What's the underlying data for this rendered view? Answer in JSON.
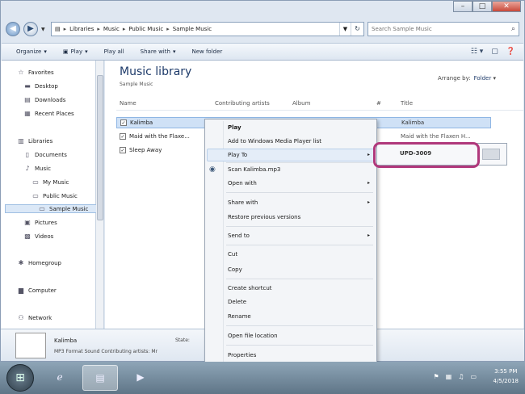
{
  "window": {
    "caption_buttons": [
      "–",
      "□",
      "✕"
    ]
  },
  "address": {
    "crumbs": [
      "Libraries",
      "Music",
      "Public Music",
      "Sample Music"
    ],
    "search_placeholder": "Search Sample Music"
  },
  "toolbar": {
    "organize": "Organize",
    "play": "Play",
    "play_all": "Play all",
    "share_with": "Share with",
    "new_folder": "New folder"
  },
  "navpane": {
    "favorites": "Favorites",
    "desktop": "Desktop",
    "downloads": "Downloads",
    "recent_places": "Recent Places",
    "libraries": "Libraries",
    "documents": "Documents",
    "music": "Music",
    "my_music": "My Music",
    "public_music": "Public Music",
    "sample_music": "Sample Music",
    "pictures": "Pictures",
    "videos": "Videos",
    "homegroup": "Homegroup",
    "computer": "Computer",
    "network": "Network"
  },
  "content": {
    "title": "Music library",
    "subtitle": "Sample Music",
    "arrange_label": "Arrange by:",
    "arrange_value": "Folder",
    "columns": [
      "Name",
      "Contributing artists",
      "Album",
      "#",
      "Title"
    ],
    "rows": [
      {
        "name": "Kalimba",
        "title": "Kalimba"
      },
      {
        "name": "Maid with the Flaxe...",
        "title": "Maid with the Flaxen H..."
      },
      {
        "name": "Sleep Away",
        "title": ""
      }
    ]
  },
  "context_menu": {
    "items": [
      "Play",
      "Add to Windows Media Player list",
      "Play To",
      "Scan Kalimba.mp3",
      "Open with",
      "Share with",
      "Restore previous versions",
      "Send to",
      "Cut",
      "Copy",
      "Create shortcut",
      "Delete",
      "Rename",
      "Open file location",
      "Properties"
    ]
  },
  "submenu": {
    "device": "UPD-3009"
  },
  "details": {
    "name": "Kalimba",
    "description": "MP3 Format Sound  Contributing artists: Mr",
    "state_label": "State:"
  },
  "taskbar": {
    "time": "3:55 PM",
    "date": "4/5/2018"
  }
}
